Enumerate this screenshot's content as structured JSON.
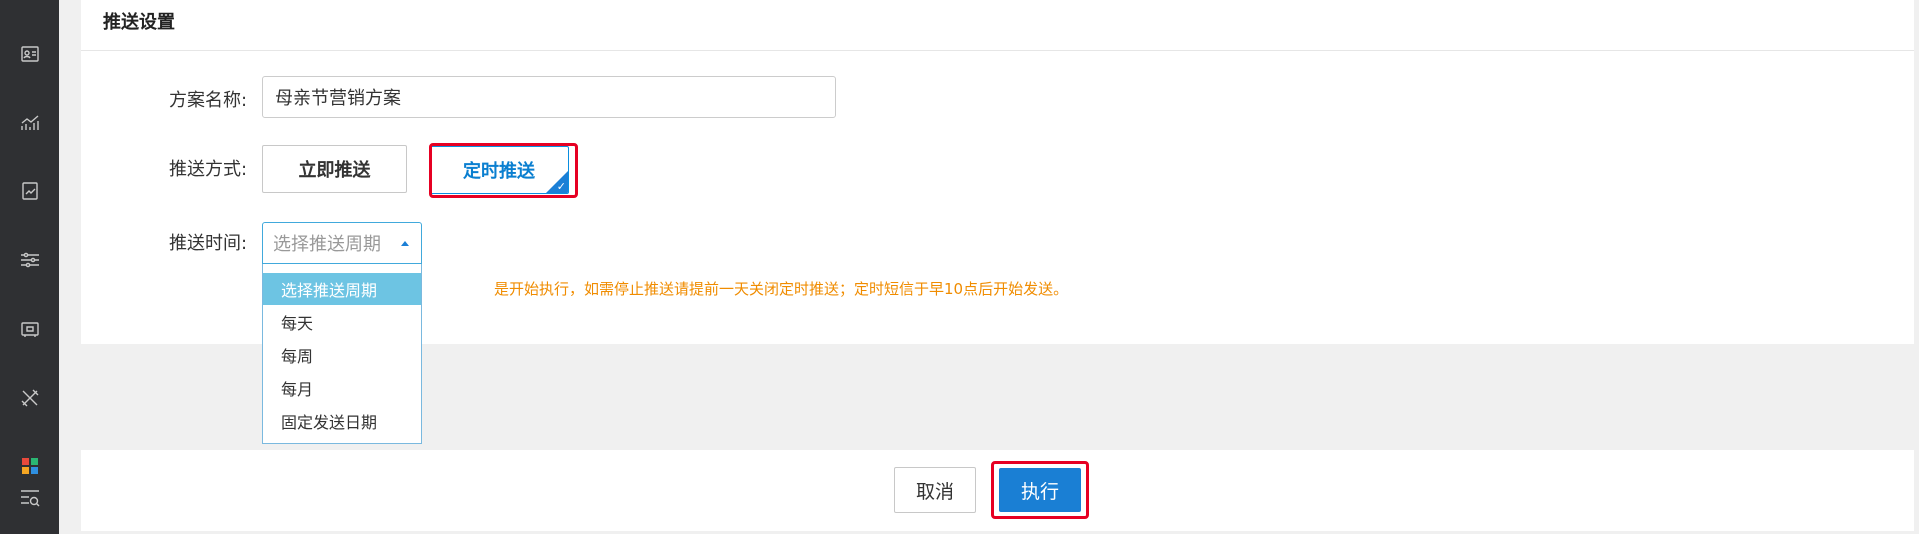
{
  "sidebar": {
    "icons": [
      "contact-card-icon",
      "trend-chart-icon",
      "report-icon",
      "sliders-icon",
      "register-icon",
      "tools-icon",
      "apps-grid-icon",
      "search-list-icon"
    ]
  },
  "panel": {
    "title": "推送设置"
  },
  "form": {
    "plan_name_label": "方案名称:",
    "plan_name_value": "母亲节营销方案",
    "push_method_label": "推送方式:",
    "push_immediate": "立即推送",
    "push_scheduled": "定时推送",
    "push_time_label": "推送时间:",
    "push_time_placeholder": "选择推送周期",
    "hint": "前一天开始执行，如需停止推送请提前一天关闭定时推送；定时短信于早10点后开始发送。",
    "hint_visible": "是开始执行，如需停止推送请提前一天关闭定时推送；定时短信于早10点后开始发送。"
  },
  "dropdown": {
    "options": [
      "选择推送周期",
      "每天",
      "每周",
      "每月",
      "固定发送日期"
    ],
    "selected_index": 0
  },
  "footer": {
    "cancel_label": "取消",
    "run_label": "执行"
  },
  "colors": {
    "accent": "#1a7fd4",
    "highlight": "#e60023",
    "hint": "#f08c00",
    "sidebar": "#2f3033"
  }
}
